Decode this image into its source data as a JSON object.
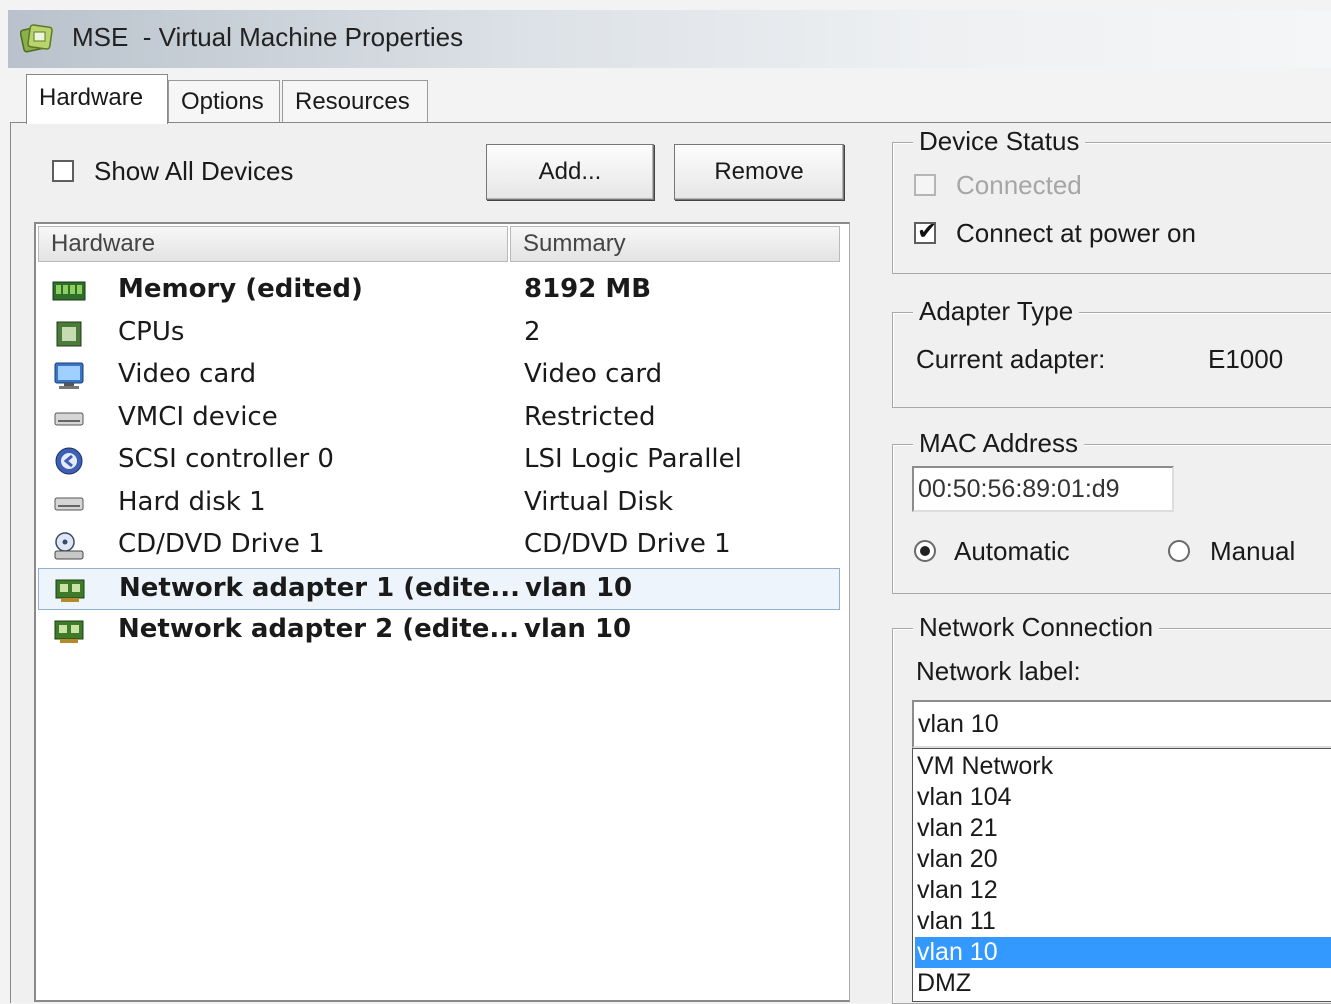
{
  "window": {
    "title_main": "MSE",
    "title_rest": "  - Virtual Machine Properties"
  },
  "tabs": [
    {
      "label": "Hardware",
      "active": true
    },
    {
      "label": "Options",
      "active": false
    },
    {
      "label": "Resources",
      "active": false
    }
  ],
  "toolbar": {
    "show_all_devices_label": "Show All Devices",
    "show_all_devices_checked": false,
    "add_label": "Add...",
    "remove_label": "Remove"
  },
  "hardware_list": {
    "columns": [
      "Hardware",
      "Summary"
    ],
    "rows": [
      {
        "icon": "memory-icon",
        "name": "Memory (edited)",
        "summary": "8192 MB",
        "bold": true,
        "selected": false
      },
      {
        "icon": "cpu-icon",
        "name": "CPUs",
        "summary": "2",
        "bold": false,
        "selected": false
      },
      {
        "icon": "video-card-icon",
        "name": "Video card",
        "summary": "Video card",
        "bold": false,
        "selected": false
      },
      {
        "icon": "vmci-device-icon",
        "name": "VMCI device",
        "summary": "Restricted",
        "bold": false,
        "selected": false
      },
      {
        "icon": "scsi-controller-icon",
        "name": "SCSI controller 0",
        "summary": "LSI Logic Parallel",
        "bold": false,
        "selected": false
      },
      {
        "icon": "hard-disk-icon",
        "name": "Hard disk 1",
        "summary": "Virtual Disk",
        "bold": false,
        "selected": false
      },
      {
        "icon": "cd-dvd-drive-icon",
        "name": "CD/DVD Drive 1",
        "summary": "CD/DVD Drive 1",
        "bold": false,
        "selected": false
      },
      {
        "icon": "network-adapter-icon",
        "name": "Network adapter 1 (edite...",
        "summary": "vlan 10",
        "bold": true,
        "selected": true
      },
      {
        "icon": "network-adapter-icon",
        "name": "Network adapter 2 (edite...",
        "summary": "vlan 10",
        "bold": true,
        "selected": false
      }
    ]
  },
  "device_status": {
    "title": "Device Status",
    "connected_label": "Connected",
    "connected_checked": false,
    "connected_enabled": false,
    "connect_power_on_label": "Connect at power on",
    "connect_power_on_checked": true
  },
  "adapter_type": {
    "title": "Adapter Type",
    "current_label": "Current adapter:",
    "current_value": "E1000"
  },
  "mac_address": {
    "title": "MAC Address",
    "value": "00:50:56:89:01:d9",
    "automatic_label": "Automatic",
    "manual_label": "Manual",
    "selected": "automatic"
  },
  "network_connection": {
    "title": "Network Connection",
    "network_label_text": "Network label:",
    "selected_value": "vlan 10",
    "options": [
      "VM Network",
      "vlan 104",
      "vlan 21",
      "vlan 20",
      "vlan 12",
      "vlan 11",
      "vlan 10",
      "DMZ"
    ],
    "highlighted_index": 6
  },
  "colors": {
    "selection_blue": "#3399ff",
    "row_selected_bg": "#eef4fb"
  }
}
